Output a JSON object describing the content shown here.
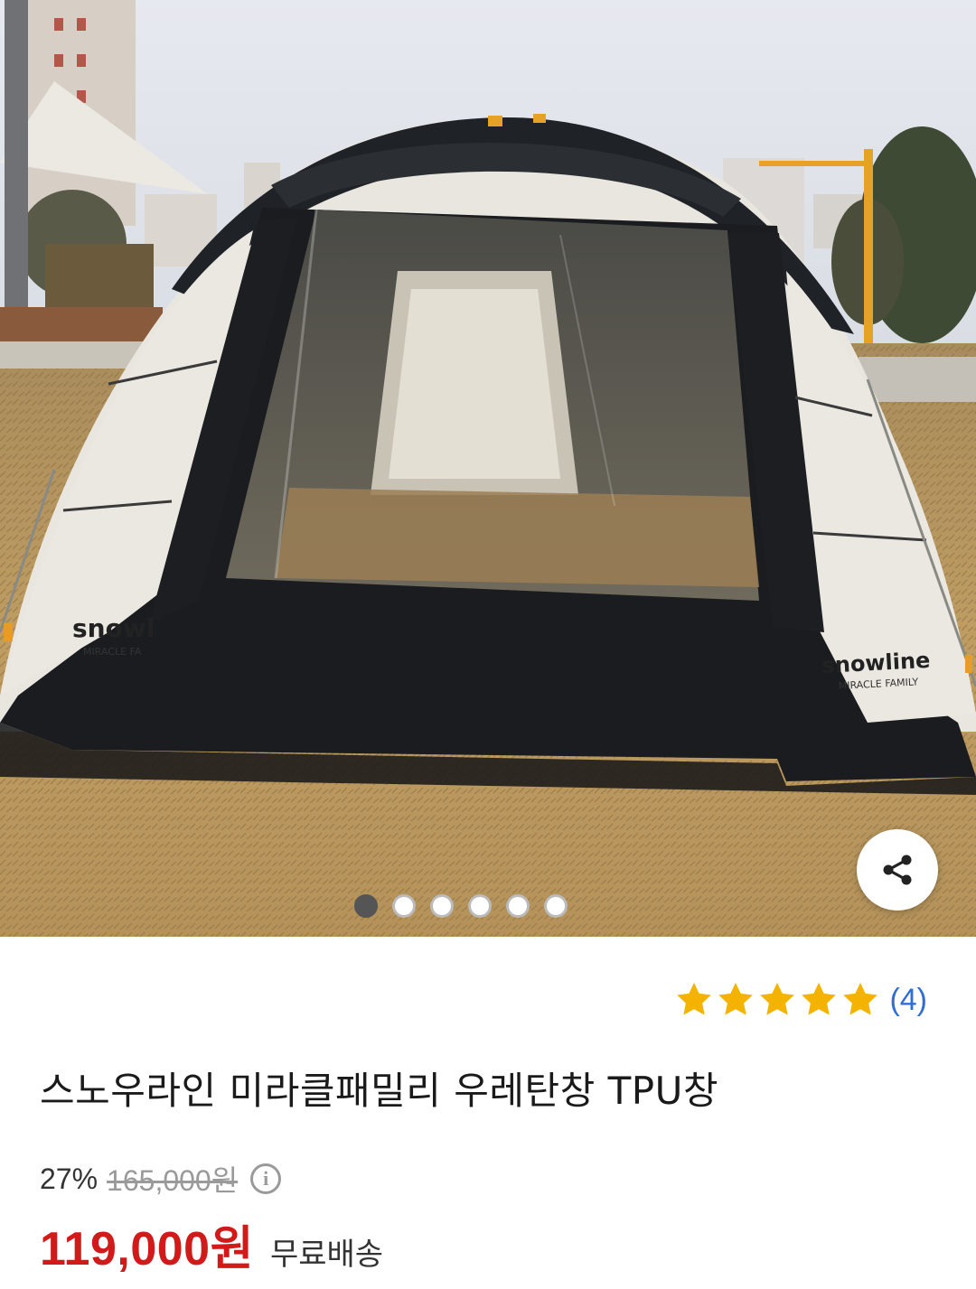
{
  "product": {
    "image": {
      "description_icon": "tent-photo",
      "logo_text_left": "snowline",
      "logo_sub_left": "MIRACLE FAMILY",
      "logo_text_right": "snowline",
      "logo_sub_right": "MIRACLE FAMILY",
      "carousel_total": 6,
      "carousel_active": 1
    },
    "share_icon": "share-icon",
    "rating": {
      "stars": 5,
      "count_label": "(4)"
    },
    "title": "스노우라인 미라클패밀리 우레탄창 TPU창",
    "discount_percent": "27%",
    "original_price": "165,000원",
    "info_icon": "info-icon",
    "sale_price": "119,000원",
    "shipping_label": "무료배송"
  },
  "colors": {
    "sale_price": "#d11a1a",
    "rating_count": "#2f6ed3",
    "star": "#f5b301"
  }
}
